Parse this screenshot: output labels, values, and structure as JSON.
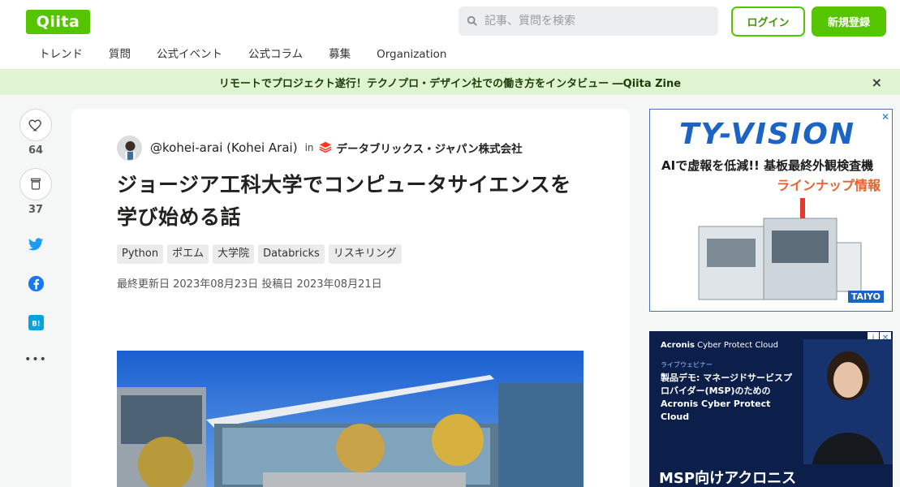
{
  "header": {
    "logo_text": "Qiita",
    "search_placeholder": "記事、質問を検索",
    "login_label": "ログイン",
    "signup_label": "新規登録",
    "nav": [
      "トレンド",
      "質問",
      "公式イベント",
      "公式コラム",
      "募集",
      "Organization"
    ]
  },
  "banner": {
    "text": "リモートでプロジェクト遂行！テクノプロ・デザイン社での働き方をインタビュー ―Qiita Zine",
    "close": "×"
  },
  "actions": {
    "likes": "64",
    "stocks": "37",
    "twitter_icon": "twitter-icon",
    "facebook_icon": "facebook-icon",
    "hatena_icon": "hatena-bookmark-icon",
    "hatena_label": "B!",
    "more_label": "•••"
  },
  "article": {
    "author": "@kohei-arai (Kohei Arai)",
    "in_word": "in",
    "organization": "データブリックス・ジャパン株式会社",
    "title": "ジョージア工科大学でコンピュータサイエンスを学び始める話",
    "tags": [
      "Python",
      "ポエム",
      "大学院",
      "Databricks",
      "リスキリング"
    ],
    "updated": "最終更新日 2023年08月23日",
    "posted": "投稿日 2023年08月21日"
  },
  "ads": {
    "ad1": {
      "brand": "TY-VISION",
      "line1": "AIで虚報を低減!! 基板最終外観検査機",
      "line2": "ラインナップ情報",
      "maker": "TAIYO"
    },
    "ad2": {
      "brand": "Acronis",
      "brand_suffix": "Cyber Protect Cloud",
      "live": "ライブウェビナー",
      "body": "製品デモ: マネージドサービスプロバイダー(MSP)のためのAcronis Cyber Protect Cloud",
      "bottom": "MSP向けアクロニス"
    }
  },
  "colors": {
    "brand_green": "#55c500",
    "banner_bg": "#dff4d0",
    "twitter": "#1d9bf0",
    "facebook": "#1877f2",
    "hatena": "#00a4de"
  }
}
